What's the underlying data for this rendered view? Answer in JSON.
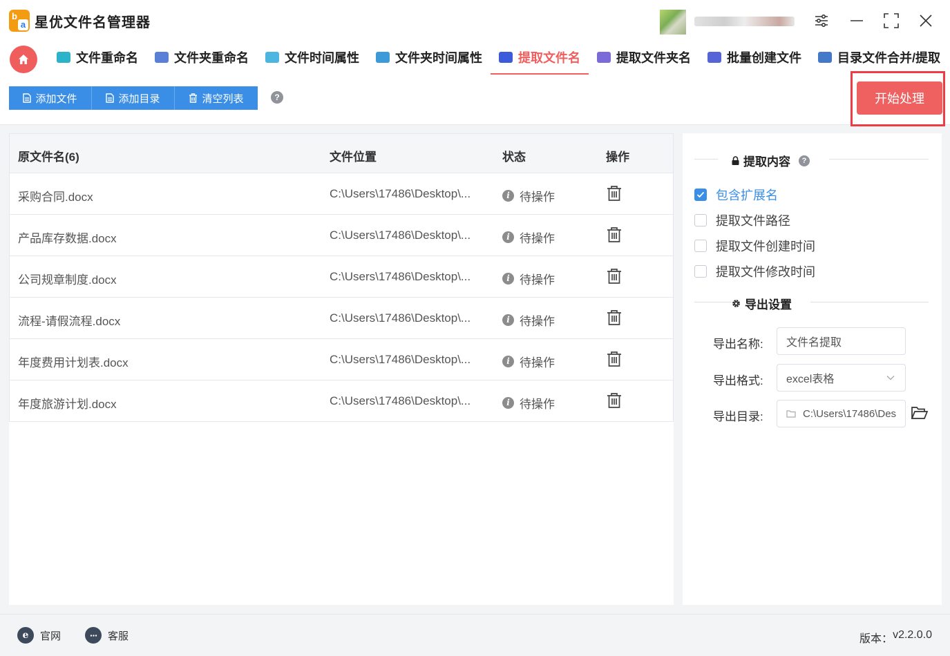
{
  "app": {
    "title": "星优文件名管理器",
    "logo_letters": {
      "top": "b",
      "bottom": "a"
    }
  },
  "window_controls": [
    "settings-icon",
    "minimize-icon",
    "maximize-icon",
    "close-icon"
  ],
  "nav": {
    "tabs": [
      {
        "label": "文件重命名",
        "icon": "rename-file-icon",
        "active": false,
        "color": "#2bb3c9"
      },
      {
        "label": "文件夹重命名",
        "icon": "rename-folder-icon",
        "active": false,
        "color": "#5a7fd6"
      },
      {
        "label": "文件时间属性",
        "icon": "file-time-icon",
        "active": false,
        "color": "#4cb6e0"
      },
      {
        "label": "文件夹时间属性",
        "icon": "folder-time-icon",
        "active": false,
        "color": "#3d9ad8"
      },
      {
        "label": "提取文件名",
        "icon": "extract-filename-icon",
        "active": true,
        "color": "#3b5bdb"
      },
      {
        "label": "提取文件夹名",
        "icon": "extract-foldername-icon",
        "active": false,
        "color": "#7a6bd9"
      },
      {
        "label": "批量创建文件",
        "icon": "batch-create-icon",
        "active": false,
        "color": "#5565d8"
      },
      {
        "label": "目录文件合并/提取",
        "icon": "merge-extract-icon",
        "active": false,
        "color": "#4479c9"
      }
    ]
  },
  "toolbar": {
    "add_file": "添加文件",
    "add_dir": "添加目录",
    "clear_list": "清空列表",
    "help": "?",
    "start": "开始处理"
  },
  "table": {
    "headers": {
      "name": "原文件名(6)",
      "location": "文件位置",
      "status": "状态",
      "action": "操作"
    },
    "rows": [
      {
        "name": "采购合同.docx",
        "location": "C:\\Users\\17486\\Desktop\\...",
        "status": "待操作"
      },
      {
        "name": "产品库存数据.docx",
        "location": "C:\\Users\\17486\\Desktop\\...",
        "status": "待操作"
      },
      {
        "name": "公司规章制度.docx",
        "location": "C:\\Users\\17486\\Desktop\\...",
        "status": "待操作"
      },
      {
        "name": "流程-请假流程.docx",
        "location": "C:\\Users\\17486\\Desktop\\...",
        "status": "待操作"
      },
      {
        "name": "年度费用计划表.docx",
        "location": "C:\\Users\\17486\\Desktop\\...",
        "status": "待操作"
      },
      {
        "name": "年度旅游计划.docx",
        "location": "C:\\Users\\17486\\Desktop\\...",
        "status": "待操作"
      }
    ]
  },
  "panel": {
    "extract_title": "提取内容",
    "options": [
      {
        "label": "包含扩展名",
        "checked": true
      },
      {
        "label": "提取文件路径",
        "checked": false
      },
      {
        "label": "提取文件创建时间",
        "checked": false
      },
      {
        "label": "提取文件修改时间",
        "checked": false
      }
    ],
    "export_title": "导出设置",
    "export_name_label": "导出名称:",
    "export_name_value": "文件名提取",
    "export_format_label": "导出格式:",
    "export_format_value": "excel表格",
    "export_dir_label": "导出目录:",
    "export_dir_value": "C:\\Users\\17486\\Des"
  },
  "footer": {
    "website": "官网",
    "support": "客服",
    "version_label": "版本：",
    "version_value": "v2.2.0.0"
  },
  "colors": {
    "accent_blue": "#3a8ee6",
    "accent_red": "#ef5d5d",
    "start_button": "#ef6060",
    "highlight_frame": "#ef3b44"
  }
}
